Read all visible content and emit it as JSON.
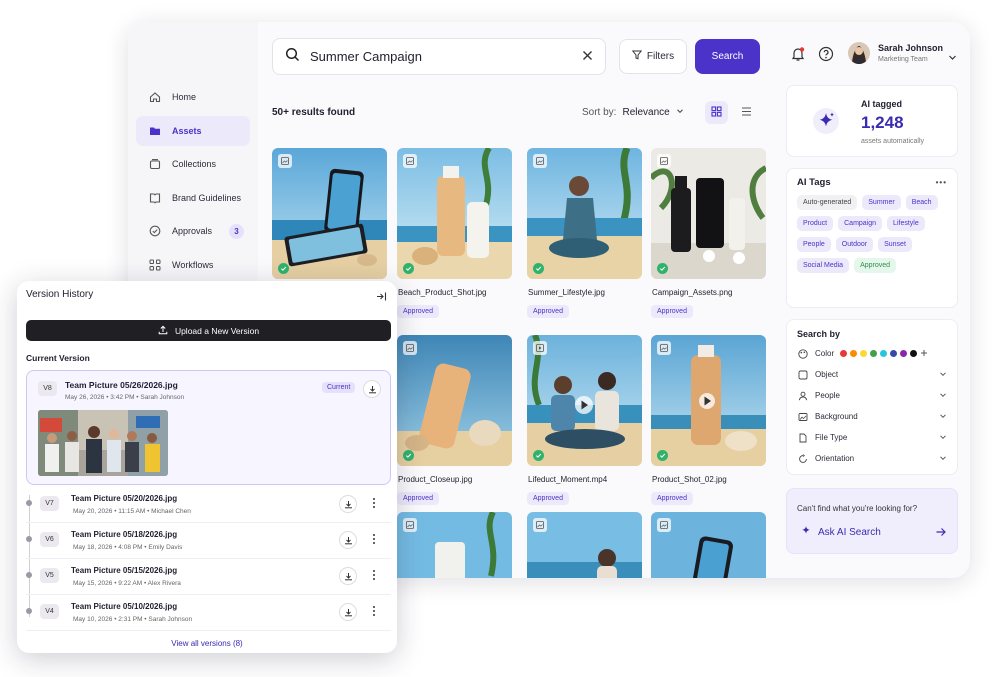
{
  "sidebar": {
    "items": [
      {
        "label": "Home",
        "icon": "home-icon"
      },
      {
        "label": "Assets",
        "icon": "folder-icon",
        "active": true
      },
      {
        "label": "Collections",
        "icon": "collections-icon"
      },
      {
        "label": "Brand Guidelines",
        "icon": "book-icon"
      },
      {
        "label": "Approvals",
        "icon": "check-circle-icon",
        "badge": "3"
      },
      {
        "label": "Workflows",
        "icon": "workflow-icon"
      }
    ]
  },
  "search": {
    "query": "Summer Campaign",
    "filters_label": "Filters",
    "button_label": "Search"
  },
  "results": {
    "count_label": "50+ results found",
    "sort_label": "Sort by:",
    "sort_value": "Relevance"
  },
  "assets": [
    {
      "name": "",
      "status": ""
    },
    {
      "name": "Beach_Product_Shot.jpg",
      "status": "Approved"
    },
    {
      "name": "Summer_Lifestyle.jpg",
      "status": "Approved"
    },
    {
      "name": "Campaign_Assets.png",
      "status": "Approved"
    },
    {
      "name": "",
      "status": ""
    },
    {
      "name": "Product_Closeup.jpg",
      "status": "Approved"
    },
    {
      "name": "Lifeduct_Moment.mp4",
      "status": "Approved"
    },
    {
      "name": "Product_Shot_02.jpg",
      "status": "Approved"
    }
  ],
  "user": {
    "name": "Sarah Johnson",
    "role": "Marketing Team"
  },
  "ai_tagged": {
    "title": "AI tagged",
    "count": "1,248",
    "subtitle": "assets automatically"
  },
  "ai_tags": {
    "title": "AI Tags",
    "more": "•••",
    "tags": [
      "Auto-generated",
      "Summer",
      "Beach",
      "Product",
      "Campaign",
      "Lifestyle",
      "People",
      "Outdoor",
      "Sunset",
      "Social Media",
      "Approved"
    ]
  },
  "search_by": {
    "title": "Search by",
    "color_label": "Color",
    "colors": [
      "#e53935",
      "#fb8c00",
      "#fdd835",
      "#43a047",
      "#26c6da",
      "#3949ab",
      "#8e24aa",
      "#111111"
    ],
    "rows": [
      "Object",
      "People",
      "Background",
      "File Type",
      "Orientation"
    ]
  },
  "ask": {
    "prompt": "Can't find what you're looking for?",
    "button": "Ask AI Search"
  },
  "version_history": {
    "title": "Version History",
    "upload_label": "Upload a New Version",
    "current_heading": "Current Version",
    "current": {
      "version": "V8",
      "file": "Team Picture 05/26/2026.jpg",
      "date": "May 26, 2026",
      "time": "3:42 PM",
      "author": "Sarah Johnson",
      "badge": "Current"
    },
    "versions": [
      {
        "version": "V7",
        "file": "Team Picture 05/20/2026.jpg",
        "date": "May 20, 2026",
        "time": "11:15 AM",
        "author": "Michael Chen"
      },
      {
        "version": "V6",
        "file": "Team Picture 05/18/2026.jpg",
        "date": "May 18, 2026",
        "time": "4:08 PM",
        "author": "Emily Davis"
      },
      {
        "version": "V5",
        "file": "Team Picture 05/15/2026.jpg",
        "date": "May 15, 2026",
        "time": "9:22 AM",
        "author": "Alex Rivera"
      },
      {
        "version": "V4",
        "file": "Team Picture 05/10/2026.jpg",
        "date": "May 10, 2026",
        "time": "2:31 PM",
        "author": "Sarah Johnson"
      }
    ],
    "view_all": "View all versions (8)"
  },
  "colors": {
    "accent": "#4b33c9",
    "approved_bg": "#ece9fb",
    "success": "#2fb36b"
  }
}
